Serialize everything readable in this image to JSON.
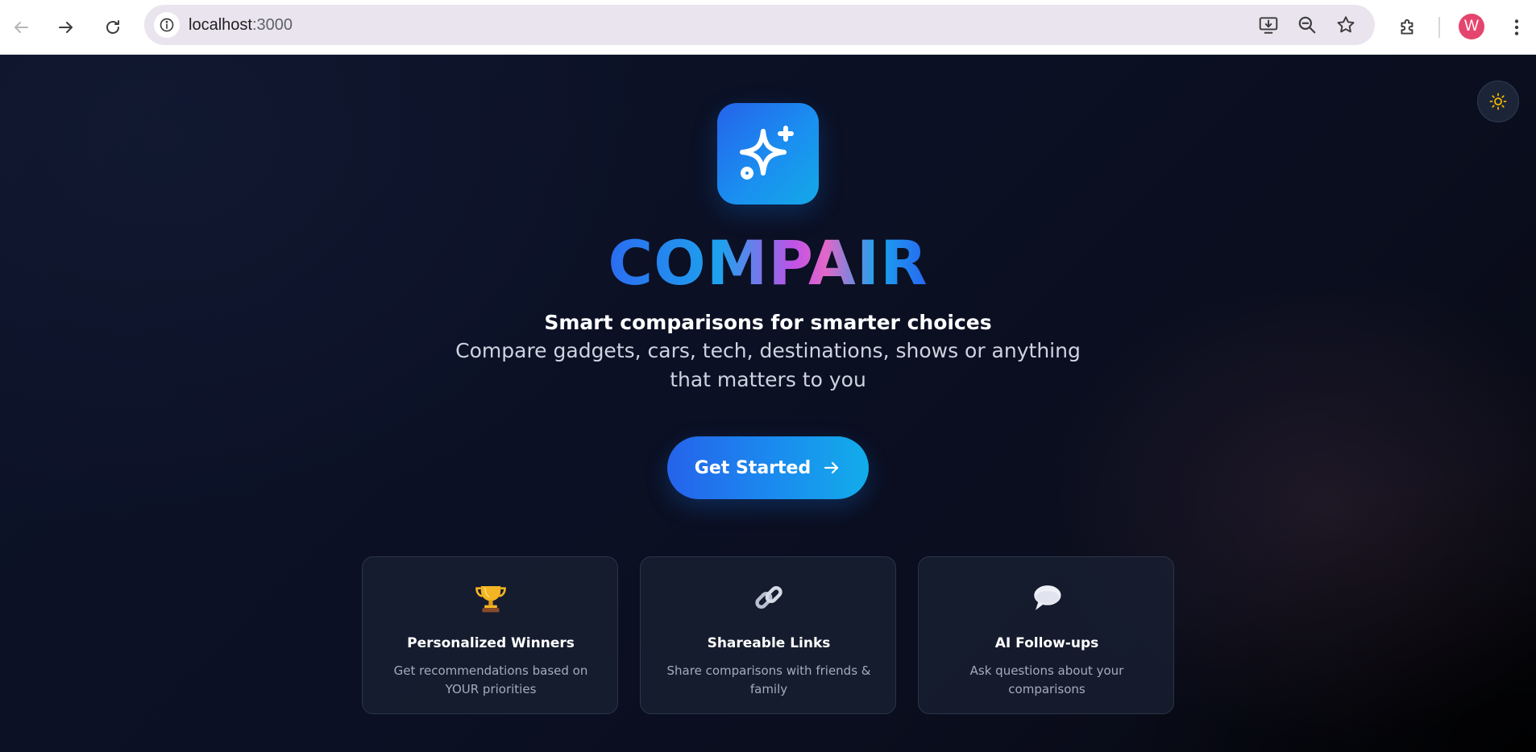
{
  "browser": {
    "url_host": "localhost",
    "url_port": ":3000",
    "profile_initial": "W",
    "icons": {
      "back": "arrow-left-icon",
      "forward": "arrow-right-icon",
      "reload": "reload-icon",
      "site_info": "info-icon",
      "install": "install-app-icon",
      "zoom": "zoom-out-icon",
      "bookmark": "star-icon",
      "extensions": "puzzle-icon",
      "menu": "kebab-menu-icon"
    },
    "avatar_color": "#e5446d"
  },
  "page": {
    "theme_toggle_icon": "sun-icon",
    "logo_icon": "sparkles-icon",
    "brand": "COMPAIR",
    "tagline": "Smart comparisons for smarter choices",
    "subtitle": "Compare gadgets, cars, tech, destinations, shows or anything that matters to you",
    "cta_label": "Get Started",
    "accent_start": "#2563eb",
    "accent_end": "#12acea",
    "features": [
      {
        "icon": "trophy-icon",
        "title": "Personalized Winners",
        "description": "Get recommendations based on YOUR priorities"
      },
      {
        "icon": "link-icon",
        "title": "Shareable Links",
        "description": "Share comparisons with friends & family"
      },
      {
        "icon": "speech-bubble-icon",
        "title": "AI Follow-ups",
        "description": "Ask questions about your comparisons"
      }
    ]
  }
}
